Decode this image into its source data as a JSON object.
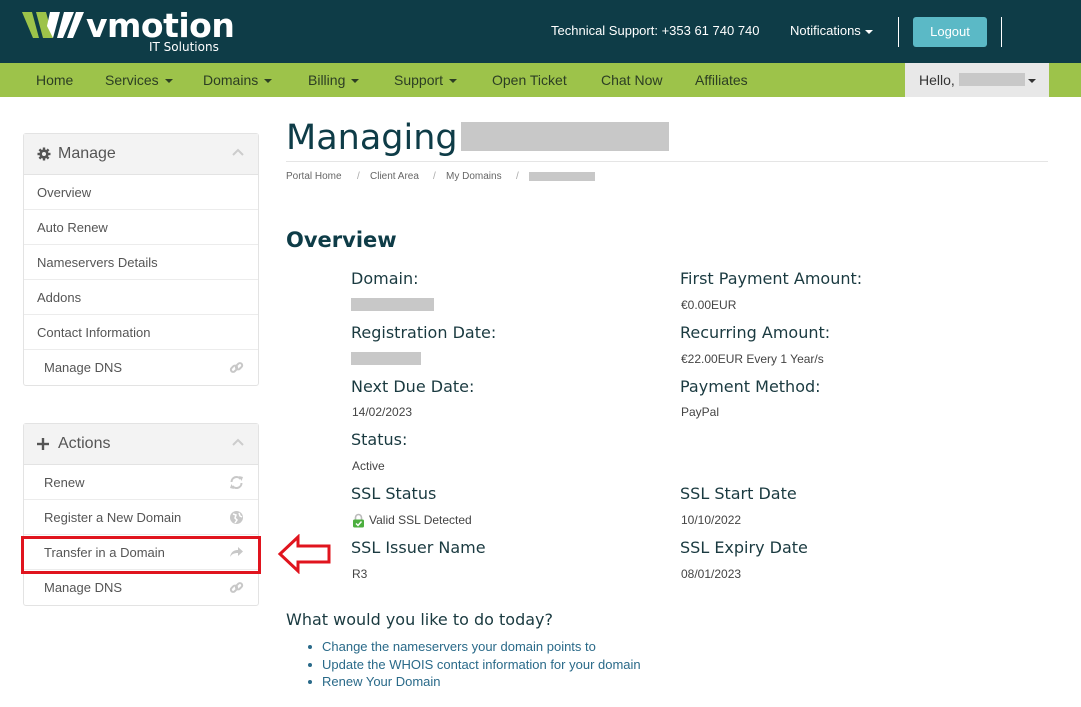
{
  "brand": {
    "name": "vmotion",
    "tagline": "IT Solutions"
  },
  "header": {
    "support": "Technical Support: +353 61 740 740",
    "notifications": "Notifications",
    "logout": "Logout"
  },
  "nav": {
    "items": [
      {
        "label": "Home"
      },
      {
        "label": "Services"
      },
      {
        "label": "Domains"
      },
      {
        "label": "Billing"
      },
      {
        "label": "Support"
      },
      {
        "label": "Open Ticket"
      },
      {
        "label": "Chat Now"
      },
      {
        "label": "Affiliates"
      }
    ],
    "hello": "Hello,"
  },
  "sidebar": {
    "manage": {
      "title": "Manage",
      "items": [
        {
          "label": "Overview"
        },
        {
          "label": "Auto Renew"
        },
        {
          "label": "Nameservers Details"
        },
        {
          "label": "Addons"
        },
        {
          "label": "Contact Information"
        },
        {
          "label": "Manage DNS",
          "icon": "link-icon"
        }
      ]
    },
    "actions": {
      "title": "Actions",
      "items": [
        {
          "label": "Renew",
          "icon": "refresh-icon"
        },
        {
          "label": "Register a New Domain",
          "icon": "globe-icon"
        },
        {
          "label": "Transfer in a Domain",
          "icon": "share-icon"
        },
        {
          "label": "Manage DNS",
          "icon": "link-icon"
        }
      ]
    }
  },
  "main": {
    "title": "Managing",
    "breadcrumb": [
      "Portal Home",
      "Client Area",
      "My Domains"
    ],
    "overview_heading": "Overview",
    "fields": {
      "domain_label": "Domain:",
      "registration_label": "Registration Date:",
      "next_due_label": "Next Due Date:",
      "next_due_value": "14/02/2023",
      "status_label": "Status:",
      "status_value": "Active",
      "ssl_status_label": "SSL Status",
      "ssl_status_value": "Valid SSL Detected",
      "ssl_issuer_label": "SSL Issuer Name",
      "ssl_issuer_value": "R3",
      "first_payment_label": "First Payment Amount:",
      "first_payment_value": "€0.00EUR",
      "recurring_label": "Recurring Amount:",
      "recurring_value": "€22.00EUR Every 1 Year/s",
      "payment_method_label": "Payment Method:",
      "payment_method_value": "PayPal",
      "ssl_start_label": "SSL Start Date",
      "ssl_start_value": "10/10/2022",
      "ssl_expiry_label": "SSL Expiry Date",
      "ssl_expiry_value": "08/01/2023"
    },
    "question": "What would you like to do today?",
    "links": [
      "Change the nameservers your domain points to",
      "Update the WHOIS contact information for your domain",
      "Renew Your Domain"
    ]
  },
  "colors": {
    "header_bg": "#0e3c47",
    "nav_bg": "#9dc34a",
    "accent_button": "#5bb9c6",
    "highlight_red": "#e0141e",
    "link": "#2a6a89"
  }
}
